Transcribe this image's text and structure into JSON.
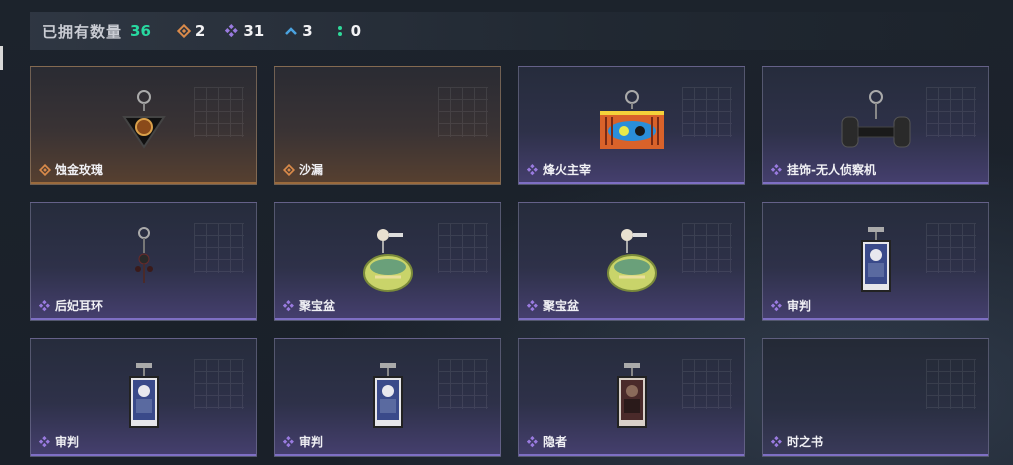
{
  "header": {
    "owned_label": "已拥有数量",
    "owned_count": "36",
    "stats": [
      {
        "icon": "gold-diamond-icon",
        "value": "2",
        "color": "#d98a4a"
      },
      {
        "icon": "purple-diamond-icon",
        "value": "31",
        "color": "#9a7be0"
      },
      {
        "icon": "blue-chevron-icon",
        "value": "3",
        "color": "#4aa3e0"
      },
      {
        "icon": "green-dots-icon",
        "value": "0",
        "color": "#2fd89a"
      }
    ]
  },
  "colors": {
    "gold": "#d98a4a",
    "purple": "#9a7be0",
    "accent_green": "#28d9a0"
  },
  "items": [
    {
      "name": "蚀金玫瑰",
      "rarity": "gold",
      "art": "rose-charm"
    },
    {
      "name": "沙漏",
      "rarity": "gold",
      "art": "none"
    },
    {
      "name": "烽火主宰",
      "rarity": "purple",
      "art": "graffiti-box"
    },
    {
      "name": "挂饰-无人侦察机",
      "rarity": "purple",
      "art": "drone"
    },
    {
      "name": "后妃耳环",
      "rarity": "purple",
      "art": "earring"
    },
    {
      "name": "聚宝盆",
      "rarity": "purple",
      "art": "treasure-bowl"
    },
    {
      "name": "聚宝盆",
      "rarity": "purple",
      "art": "treasure-bowl"
    },
    {
      "name": "审判",
      "rarity": "purple",
      "art": "card-judge"
    },
    {
      "name": "审判",
      "rarity": "purple",
      "art": "card-judge"
    },
    {
      "name": "审判",
      "rarity": "purple",
      "art": "card-judge"
    },
    {
      "name": "隐者",
      "rarity": "purple",
      "art": "card-hermit"
    },
    {
      "name": "时之书",
      "rarity": "purple",
      "art": "none"
    }
  ]
}
